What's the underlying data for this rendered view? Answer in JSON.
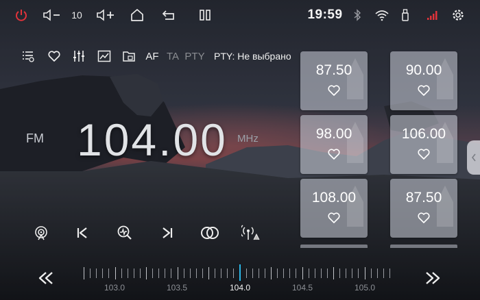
{
  "colors": {
    "power": "#e2333a",
    "accent": "#2bb8e8",
    "preset_bg": "#cdd2dc"
  },
  "statusbar": {
    "power_icon": "power-icon",
    "vol_down_icon": "volume-down-icon",
    "volume": "10",
    "vol_up_icon": "volume-up-icon",
    "home_icon": "home-icon",
    "back_icon": "back-icon",
    "recents_icon": "recents-icon",
    "time": "19:59",
    "bluetooth_icon": "bluetooth-icon",
    "wifi_icon": "wifi-icon",
    "usb_icon": "usb-icon",
    "signal_icon": "signal-icon",
    "settings_icon": "settings-icon"
  },
  "toolbar": {
    "list_icon": "station-list-icon",
    "favorite_icon": "heart-icon",
    "eq_icon": "equalizer-icon",
    "chart_icon": "signal-chart-icon",
    "rds_icon": "rds-icon",
    "af": "AF",
    "ta": "TA",
    "pty_button": "PTY",
    "pty_status": "PTY: Не выбрано"
  },
  "tuner": {
    "band": "FM",
    "frequency": "104.00",
    "unit": "MHz",
    "scale": [
      "103.0",
      "103.5",
      "104.0",
      "104.5",
      "105.0"
    ],
    "current_scale_index": 2
  },
  "presets": [
    {
      "freq": "87.50"
    },
    {
      "freq": "90.00"
    },
    {
      "freq": "98.00"
    },
    {
      "freq": "106.00"
    },
    {
      "freq": "108.00"
    },
    {
      "freq": "87.50"
    }
  ],
  "controls": {
    "scan_icon": "radio-scan-icon",
    "prev_icon": "skip-previous-icon",
    "search_icon": "search-stations-icon",
    "next_icon": "skip-next-icon",
    "stereo_icon": "stereo-icon",
    "local_dx_icon": "local-distance-icon",
    "seek_back_icon": "seek-backward-icon",
    "seek_fwd_icon": "seek-forward-icon",
    "side_handle_icon": "chevron-left-icon"
  }
}
